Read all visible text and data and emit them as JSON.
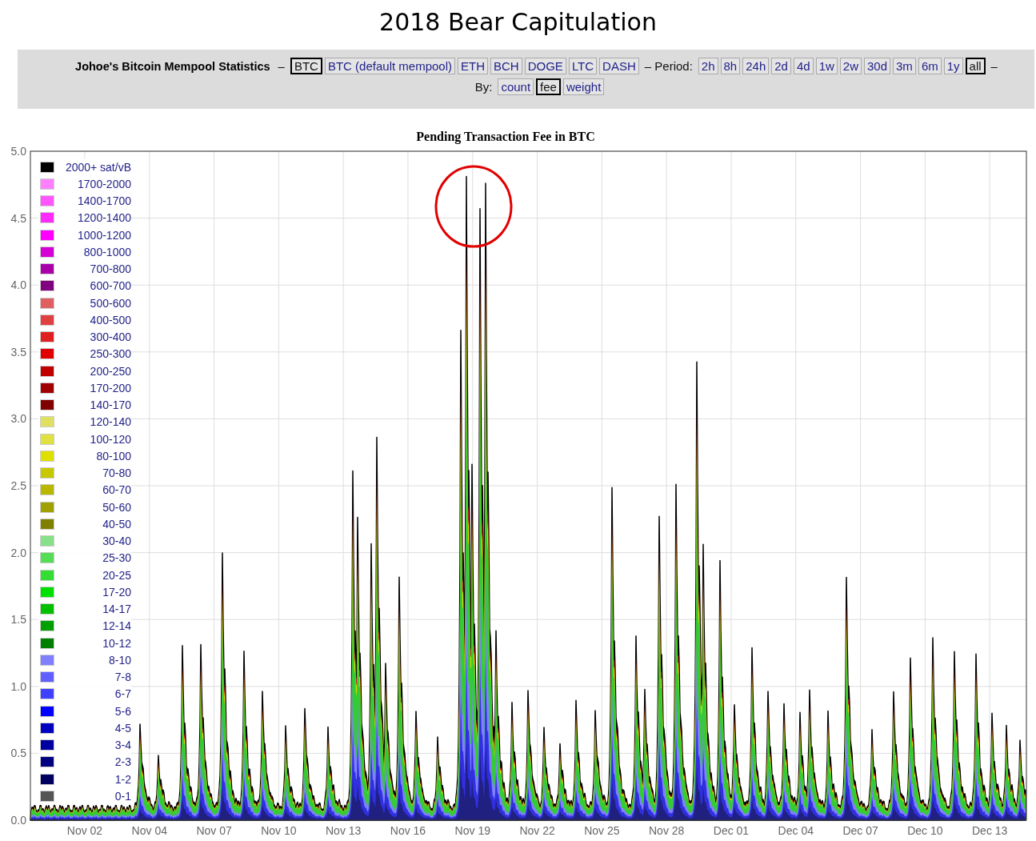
{
  "page_title": "2018 Bear Capitulation",
  "header": {
    "title": "Johoe's Bitcoin Mempool Statistics",
    "separator_1": "–",
    "coins": [
      {
        "label": "BTC",
        "selected": true
      },
      {
        "label": "BTC (default mempool)",
        "selected": false
      },
      {
        "label": "ETH",
        "selected": false
      },
      {
        "label": "BCH",
        "selected": false
      },
      {
        "label": "DOGE",
        "selected": false
      },
      {
        "label": "LTC",
        "selected": false
      },
      {
        "label": "DASH",
        "selected": false
      }
    ],
    "separator_2": "– Period:",
    "periods": [
      {
        "label": "2h",
        "selected": false
      },
      {
        "label": "8h",
        "selected": false
      },
      {
        "label": "24h",
        "selected": false
      },
      {
        "label": "2d",
        "selected": false
      },
      {
        "label": "4d",
        "selected": false
      },
      {
        "label": "1w",
        "selected": false
      },
      {
        "label": "2w",
        "selected": false
      },
      {
        "label": "30d",
        "selected": false
      },
      {
        "label": "3m",
        "selected": false
      },
      {
        "label": "6m",
        "selected": false
      },
      {
        "label": "1y",
        "selected": false
      },
      {
        "label": "all",
        "selected": true
      }
    ],
    "separator_3": "–",
    "by_label": "By:",
    "modes": [
      {
        "label": "count",
        "selected": false
      },
      {
        "label": "fee",
        "selected": true
      },
      {
        "label": "weight",
        "selected": false
      }
    ]
  },
  "chart": {
    "title": "Pending Transaction Fee in BTC",
    "y_labels": [
      "5.0",
      "4.5",
      "4.0",
      "3.5",
      "3.0",
      "2.5",
      "2.0",
      "1.5",
      "1.0",
      "0.5",
      "0.0"
    ],
    "x_labels": [
      "Nov 02",
      "Nov 04",
      "Nov 07",
      "Nov 10",
      "Nov 13",
      "Nov 16",
      "Nov 19",
      "Nov 22",
      "Nov 25",
      "Nov 28",
      "Dec 01",
      "Dec 04",
      "Dec 07",
      "Dec 10",
      "Dec 13"
    ],
    "legend": [
      {
        "label": "2000+ sat/vB",
        "color": "#000000"
      },
      {
        "label": "1700-2000",
        "color": "#ff80ff"
      },
      {
        "label": "1400-1700",
        "color": "#ff55ff"
      },
      {
        "label": "1200-1400",
        "color": "#ff2bff"
      },
      {
        "label": "1000-1200",
        "color": "#ff00ff"
      },
      {
        "label": "800-1000",
        "color": "#d500d5"
      },
      {
        "label": "700-800",
        "color": "#aa00aa"
      },
      {
        "label": "600-700",
        "color": "#800080"
      },
      {
        "label": "500-600",
        "color": "#e06060"
      },
      {
        "label": "400-500",
        "color": "#e04040"
      },
      {
        "label": "300-400",
        "color": "#e02020"
      },
      {
        "label": "250-300",
        "color": "#e00000"
      },
      {
        "label": "200-250",
        "color": "#c00000"
      },
      {
        "label": "170-200",
        "color": "#a00000"
      },
      {
        "label": "140-170",
        "color": "#800000"
      },
      {
        "label": "120-140",
        "color": "#e0e060"
      },
      {
        "label": "100-120",
        "color": "#e0e040"
      },
      {
        "label": "80-100",
        "color": "#e0e000"
      },
      {
        "label": "70-80",
        "color": "#c8c800"
      },
      {
        "label": "60-70",
        "color": "#b8b800"
      },
      {
        "label": "50-60",
        "color": "#a0a000"
      },
      {
        "label": "40-50",
        "color": "#808000"
      },
      {
        "label": "30-40",
        "color": "#88e088"
      },
      {
        "label": "25-30",
        "color": "#55dd55"
      },
      {
        "label": "20-25",
        "color": "#33dd33"
      },
      {
        "label": "17-20",
        "color": "#00e000"
      },
      {
        "label": "14-17",
        "color": "#00c000"
      },
      {
        "label": "12-14",
        "color": "#00a000"
      },
      {
        "label": "10-12",
        "color": "#008000"
      },
      {
        "label": "8-10",
        "color": "#8080ff"
      },
      {
        "label": "7-8",
        "color": "#6060ff"
      },
      {
        "label": "6-7",
        "color": "#4040ff"
      },
      {
        "label": "5-6",
        "color": "#0000ff"
      },
      {
        "label": "4-5",
        "color": "#0000c0"
      },
      {
        "label": "3-4",
        "color": "#0000a0"
      },
      {
        "label": "2-3",
        "color": "#000080"
      },
      {
        "label": "1-2",
        "color": "#000060"
      },
      {
        "label": "0-1",
        "color": "#555555"
      }
    ]
  }
}
